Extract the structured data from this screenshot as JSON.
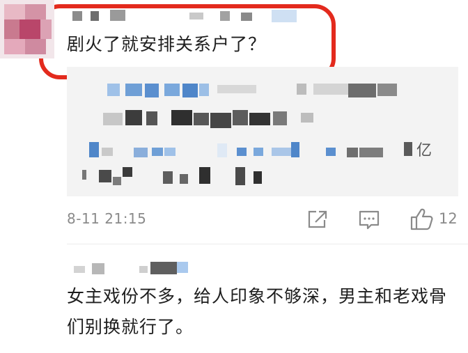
{
  "comment1": {
    "text": "剧火了就安排关系户了？",
    "time": "8-11 21:15",
    "like_count": "12",
    "quote_tail": "亿"
  },
  "comment2": {
    "text": "女主戏份不多，给人印象不够深，男主和老戏骨们别换就行了。"
  },
  "icons": [
    "share-icon",
    "comment-icon",
    "thumbs-up-icon"
  ],
  "colors": {
    "highlight": "#e32a1d",
    "meta_gray": "#8a8a8a",
    "quote_bg": "#f3f3f3"
  }
}
